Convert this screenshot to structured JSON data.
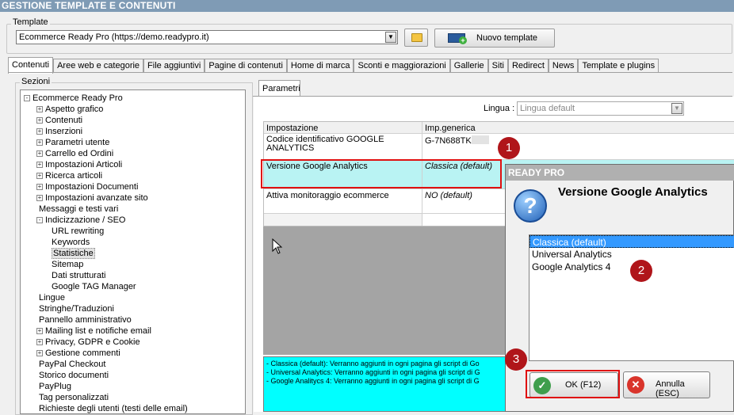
{
  "window": {
    "title": "GESTIONE TEMPLATE E CONTENUTI"
  },
  "template": {
    "legend": "Template",
    "selected": "Ecommerce Ready Pro (https://demo.readypro.it)",
    "new_button": "Nuovo template"
  },
  "tabs": [
    {
      "label": "Contenuti",
      "active": true
    },
    {
      "label": "Aree web e categorie"
    },
    {
      "label": "File aggiuntivi"
    },
    {
      "label": "Pagine di contenuti"
    },
    {
      "label": "Home di marca"
    },
    {
      "label": "Sconti e maggiorazioni"
    },
    {
      "label": "Gallerie"
    },
    {
      "label": "Siti"
    },
    {
      "label": "Redirect"
    },
    {
      "label": "News"
    },
    {
      "label": "Template e plugins"
    }
  ],
  "sezioni": {
    "legend": "Sezioni",
    "tree": [
      {
        "label": "Ecommerce Ready Pro",
        "level": 0,
        "exp": "-"
      },
      {
        "label": "Aspetto grafico",
        "level": 1,
        "exp": "+"
      },
      {
        "label": "Contenuti",
        "level": 1,
        "exp": "+"
      },
      {
        "label": "Inserzioni",
        "level": 1,
        "exp": "+"
      },
      {
        "label": "Parametri utente",
        "level": 1,
        "exp": "+"
      },
      {
        "label": "Carrello ed Ordini",
        "level": 1,
        "exp": "+"
      },
      {
        "label": "Impostazioni Articoli",
        "level": 1,
        "exp": "+"
      },
      {
        "label": "Ricerca articoli",
        "level": 1,
        "exp": "+"
      },
      {
        "label": "Impostazioni Documenti",
        "level": 1,
        "exp": "+"
      },
      {
        "label": "Impostazioni avanzate sito",
        "level": 1,
        "exp": "+"
      },
      {
        "label": "Messaggi e testi vari",
        "level": 1,
        "exp": ""
      },
      {
        "label": "Indicizzazione / SEO",
        "level": 1,
        "exp": "-"
      },
      {
        "label": "URL rewriting",
        "level": 2,
        "exp": ""
      },
      {
        "label": "Keywords",
        "level": 2,
        "exp": ""
      },
      {
        "label": "Statistiche",
        "level": 2,
        "exp": "",
        "selected": true
      },
      {
        "label": "Sitemap",
        "level": 2,
        "exp": ""
      },
      {
        "label": "Dati strutturati",
        "level": 2,
        "exp": ""
      },
      {
        "label": "Google TAG Manager",
        "level": 2,
        "exp": ""
      },
      {
        "label": "Lingue",
        "level": 1,
        "exp": ""
      },
      {
        "label": "Stringhe/Traduzioni",
        "level": 1,
        "exp": ""
      },
      {
        "label": "Pannello amministrativo",
        "level": 1,
        "exp": ""
      },
      {
        "label": "Mailing list e notifiche email",
        "level": 1,
        "exp": "+"
      },
      {
        "label": "Privacy, GDPR e Cookie",
        "level": 1,
        "exp": "+"
      },
      {
        "label": "Gestione commenti",
        "level": 1,
        "exp": "+"
      },
      {
        "label": "PayPal Checkout",
        "level": 1,
        "exp": ""
      },
      {
        "label": "Storico documenti",
        "level": 1,
        "exp": ""
      },
      {
        "label": "PayPlug",
        "level": 1,
        "exp": ""
      },
      {
        "label": "Tag personalizzati",
        "level": 1,
        "exp": ""
      },
      {
        "label": "Richieste degli utenti (testi delle email)",
        "level": 1,
        "exp": ""
      }
    ]
  },
  "parametri": {
    "tab": "Parametri",
    "lingua_label": "Lingua :",
    "lingua_value": "Lingua default",
    "grid": {
      "col_setting": "Impostazione",
      "col_value": "Imp.generica",
      "rows": [
        {
          "setting": "Codice identificativo GOOGLE ANALYTICS",
          "value": "G-7N688TK"
        },
        {
          "setting": "Versione Google Analytics",
          "value": "Classica (default)"
        },
        {
          "setting": "Attiva monitoraggio ecommerce",
          "value": "NO (default)"
        }
      ]
    },
    "description": [
      "- Classica (default): Verranno aggiunti in ogni pagina gli script di Go",
      "- Universal Analytics: Verranno aggiunti in ogni pagina gli script di G",
      "- Google Analitycs 4: Verranno aggiunti in ogni pagina gli script di G"
    ]
  },
  "dialog": {
    "title": "READY PRO",
    "heading": "Versione Google Analytics",
    "options": [
      "Classica (default)",
      "Universal Analytics",
      "Google Analytics 4"
    ],
    "ok_label": "OK (F12)",
    "cancel_label": "Annulla (ESC)"
  },
  "badges": [
    "1",
    "2",
    "3"
  ],
  "colors": {
    "highlight_red": "#e01010",
    "badge": "#b0151a",
    "selection": "#3399ff",
    "cyan_field": "#00ffff"
  }
}
